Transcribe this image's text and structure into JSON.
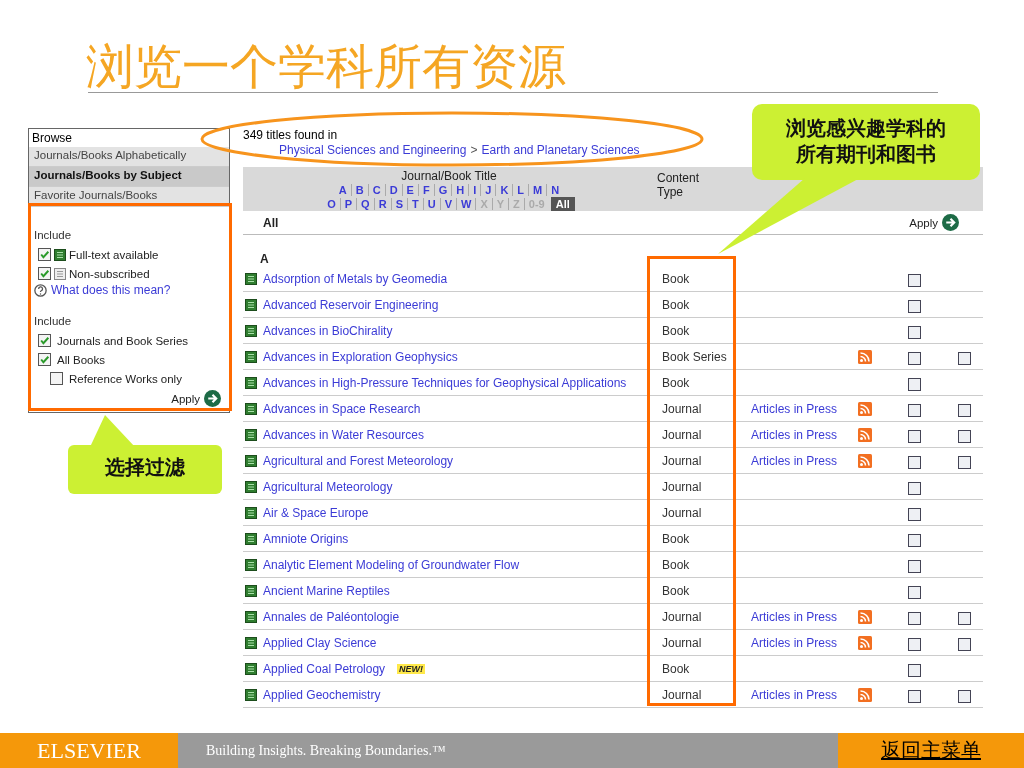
{
  "title": "浏览一个学科所有资源",
  "sidebar": {
    "heading": "Browse",
    "nav": [
      {
        "label": "Journals/Books Alphabetically",
        "selected": false
      },
      {
        "label": "Journals/Books by Subject",
        "selected": true
      },
      {
        "label": "Favorite Journals/Books",
        "selected": false
      }
    ],
    "include_access": {
      "label": "Include",
      "options": [
        {
          "label": "Full-text available",
          "checked": true,
          "kind": "full-text"
        },
        {
          "label": "Non-subscribed",
          "checked": true,
          "kind": "non-subscribed"
        }
      ]
    },
    "help_link": "What does this mean?",
    "include_types": {
      "label": "Include",
      "options": [
        {
          "label": "Journals and Book Series",
          "checked": true
        },
        {
          "label": "All Books",
          "checked": true,
          "children": [
            {
              "label": "Reference Works only",
              "checked": false
            }
          ]
        }
      ]
    },
    "apply": "Apply"
  },
  "results": {
    "count_text": "349 titles found in",
    "breadcrumb": [
      "Physical Sciences and Engineering",
      "Earth and Planetary Sciences"
    ],
    "breadcrumb_separator": ">",
    "columns": [
      "Journal/Book Title",
      "Content Type"
    ],
    "letters": [
      {
        "label": "A",
        "selected": false,
        "disabled": false
      },
      {
        "label": "B",
        "selected": false,
        "disabled": false
      },
      {
        "label": "C",
        "selected": false,
        "disabled": false
      },
      {
        "label": "D",
        "selected": false,
        "disabled": false
      },
      {
        "label": "E",
        "selected": false,
        "disabled": false
      },
      {
        "label": "F",
        "selected": false,
        "disabled": false
      },
      {
        "label": "G",
        "selected": false,
        "disabled": false
      },
      {
        "label": "H",
        "selected": false,
        "disabled": false
      },
      {
        "label": "I",
        "selected": false,
        "disabled": false
      },
      {
        "label": "J",
        "selected": false,
        "disabled": false
      },
      {
        "label": "K",
        "selected": false,
        "disabled": false
      },
      {
        "label": "L",
        "selected": false,
        "disabled": false
      },
      {
        "label": "M",
        "selected": false,
        "disabled": false
      },
      {
        "label": "N",
        "selected": false,
        "disabled": false
      },
      {
        "label": "O",
        "selected": false,
        "disabled": false
      },
      {
        "label": "P",
        "selected": false,
        "disabled": false
      },
      {
        "label": "Q",
        "selected": false,
        "disabled": false
      },
      {
        "label": "R",
        "selected": false,
        "disabled": false
      },
      {
        "label": "S",
        "selected": false,
        "disabled": false
      },
      {
        "label": "T",
        "selected": false,
        "disabled": false
      },
      {
        "label": "U",
        "selected": false,
        "disabled": false
      },
      {
        "label": "V",
        "selected": false,
        "disabled": false
      },
      {
        "label": "W",
        "selected": false,
        "disabled": false
      },
      {
        "label": "X",
        "selected": false,
        "disabled": true
      },
      {
        "label": "Y",
        "selected": false,
        "disabled": true
      },
      {
        "label": "Z",
        "selected": false,
        "disabled": true
      },
      {
        "label": "0-9",
        "selected": false,
        "disabled": true
      },
      {
        "label": "All",
        "selected": true,
        "disabled": false
      }
    ],
    "filter_label": "All",
    "apply": "Apply",
    "section_letter": "A",
    "rows": [
      {
        "title": "Adsorption of Metals by Geomedia",
        "type": "Book",
        "favorite_checked": false
      },
      {
        "title": "Advanced Reservoir Engineering",
        "type": "Book",
        "favorite_checked": false
      },
      {
        "title": "Advances in BioChirality",
        "type": "Book",
        "favorite_checked": false
      },
      {
        "title": "Advances in Exploration Geophysics",
        "type": "Book Series",
        "feed": true,
        "favorite_checked": false,
        "alert_checked": false
      },
      {
        "title": "Advances in High-Pressure Techniques for Geophysical Applications",
        "type": "Book",
        "favorite_checked": false
      },
      {
        "title": "Advances in Space Research",
        "type": "Journal",
        "articles_in_press": "Articles in Press",
        "feed": true,
        "favorite_checked": false,
        "alert_checked": false
      },
      {
        "title": "Advances in Water Resources",
        "type": "Journal",
        "articles_in_press": "Articles in Press",
        "feed": true,
        "favorite_checked": false,
        "alert_checked": false
      },
      {
        "title": "Agricultural and Forest Meteorology",
        "type": "Journal",
        "articles_in_press": "Articles in Press",
        "feed": true,
        "favorite_checked": false,
        "alert_checked": false
      },
      {
        "title": "Agricultural Meteorology",
        "type": "Journal",
        "favorite_checked": false
      },
      {
        "title": "Air & Space Europe",
        "type": "Journal",
        "favorite_checked": false
      },
      {
        "title": "Amniote Origins",
        "type": "Book",
        "favorite_checked": false
      },
      {
        "title": "Analytic Element Modeling of Groundwater Flow",
        "type": "Book",
        "favorite_checked": false
      },
      {
        "title": "Ancient Marine Reptiles",
        "type": "Book",
        "favorite_checked": false
      },
      {
        "title": "Annales de Paléontologie",
        "type": "Journal",
        "articles_in_press": "Articles in Press",
        "feed": true,
        "favorite_checked": false,
        "alert_checked": false
      },
      {
        "title": "Applied Clay Science",
        "type": "Journal",
        "articles_in_press": "Articles in Press",
        "feed": true,
        "favorite_checked": false,
        "alert_checked": false
      },
      {
        "title": "Applied Coal Petrology",
        "badge": "NEW!",
        "type": "Book",
        "favorite_checked": false
      },
      {
        "title": "Applied Geochemistry",
        "type": "Journal",
        "articles_in_press": "Articles in Press",
        "feed": true,
        "favorite_checked": false,
        "alert_checked": false
      }
    ]
  },
  "callouts": [
    {
      "text": "浏览感兴趣学科的所有期刊和图书",
      "kind": "top"
    },
    {
      "text": "选择过滤",
      "kind": "bottom"
    }
  ],
  "footer": {
    "logo": "ELSEVIER",
    "tagline": "Building Insights. Breaking Boundaries.™",
    "back_link": "返回主菜单"
  }
}
